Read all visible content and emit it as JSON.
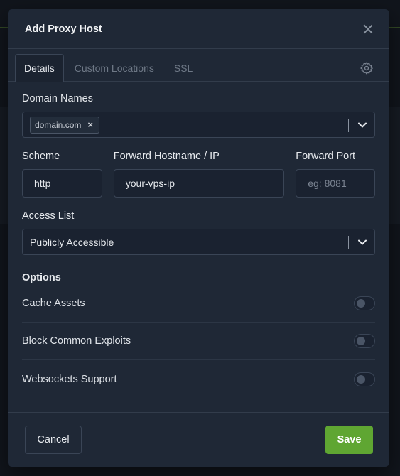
{
  "modal": {
    "title": "Add Proxy Host"
  },
  "tabs": [
    {
      "label": "Details",
      "active": true
    },
    {
      "label": "Custom Locations",
      "active": false
    },
    {
      "label": "SSL",
      "active": false
    }
  ],
  "tab_settings_icon": "gear-icon",
  "domain_names": {
    "label": "Domain Names",
    "chips": [
      "domain.com"
    ]
  },
  "scheme": {
    "label": "Scheme",
    "value": "http"
  },
  "forward_host": {
    "label": "Forward Hostname / IP",
    "value": "your-vps-ip"
  },
  "forward_port": {
    "label": "Forward Port",
    "placeholder": "eg: 8081",
    "value": ""
  },
  "access_list": {
    "label": "Access List",
    "value": "Publicly Accessible"
  },
  "options": {
    "title": "Options",
    "items": [
      {
        "label": "Cache Assets",
        "enabled": false
      },
      {
        "label": "Block Common Exploits",
        "enabled": false
      },
      {
        "label": "Websockets Support",
        "enabled": false
      }
    ]
  },
  "footer": {
    "cancel_label": "Cancel",
    "save_label": "Save"
  },
  "colors": {
    "accent": "#5fa632",
    "modal_bg": "#1f2836",
    "page_bg": "#11151c"
  }
}
